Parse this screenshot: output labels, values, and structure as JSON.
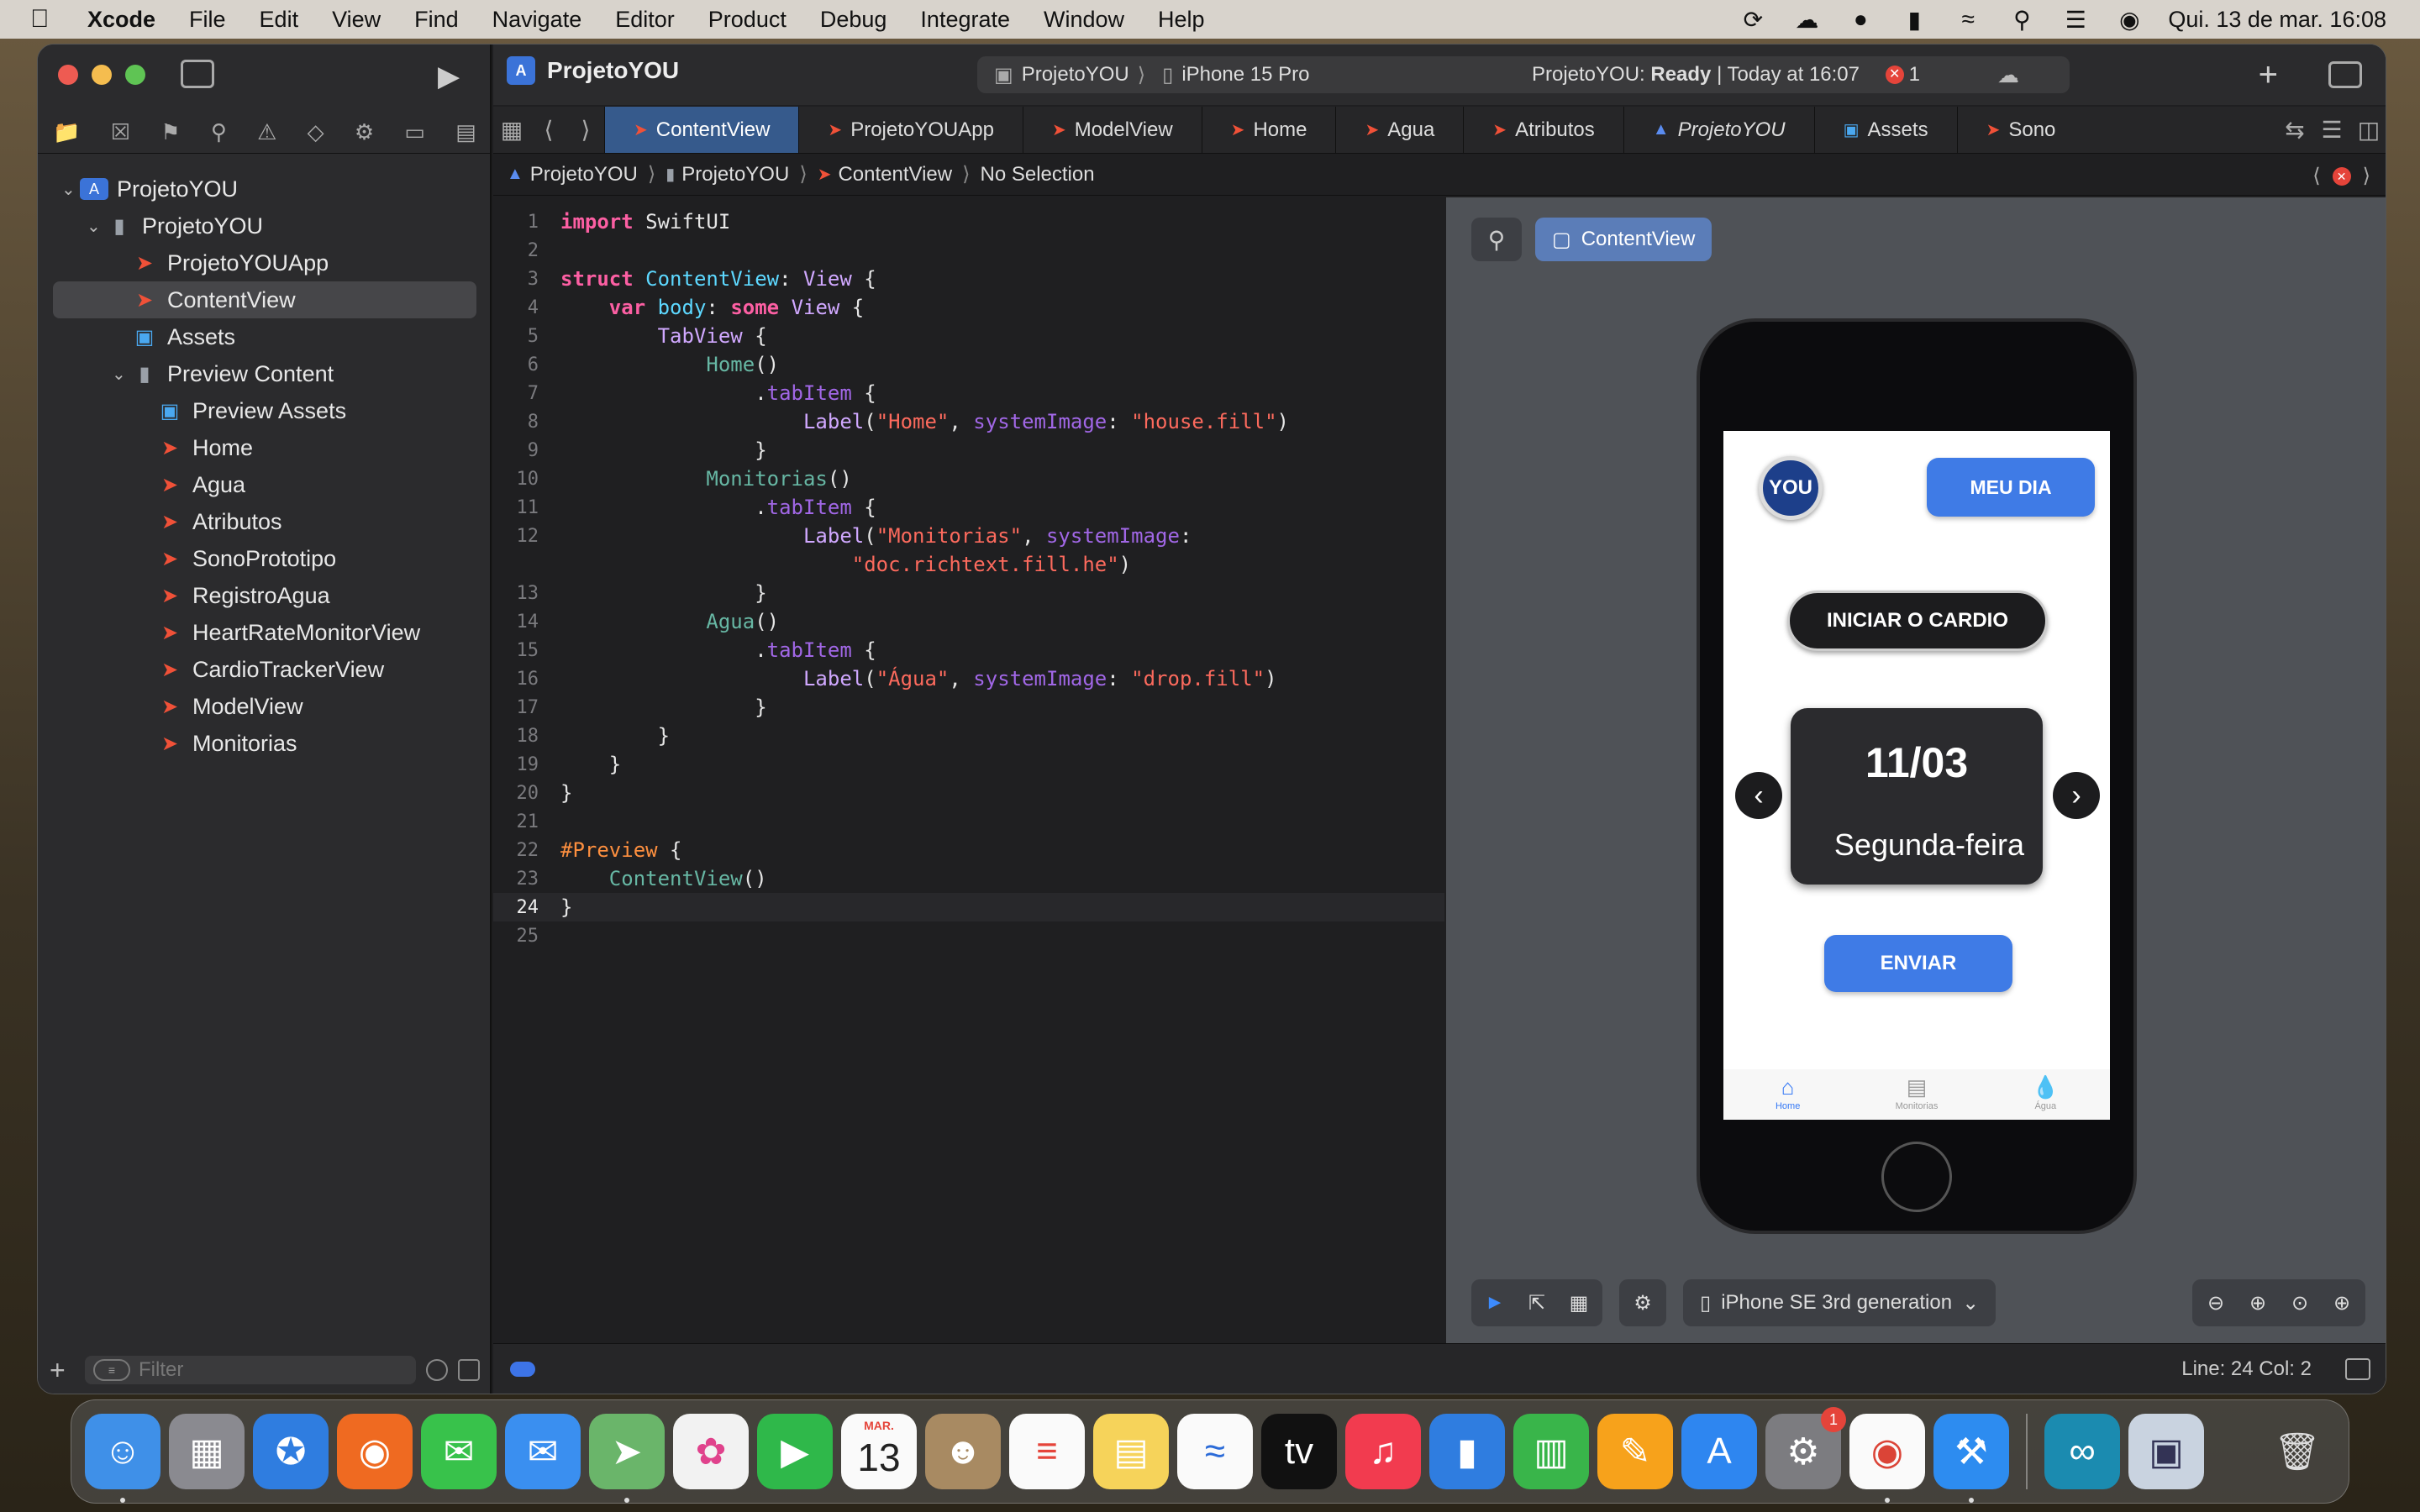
{
  "menubar": {
    "app_name": "Xcode",
    "items": [
      "File",
      "Edit",
      "View",
      "Find",
      "Navigate",
      "Editor",
      "Product",
      "Debug",
      "Integrate",
      "Window",
      "Help"
    ],
    "clock": "Qui. 13 de mar.  16:08"
  },
  "toolbar": {
    "project_name": "ProjetoYOU",
    "scheme": "ProjetoYOU",
    "device": "iPhone 15 Pro",
    "status_prefix": "ProjetoYOU: ",
    "status_state": "Ready",
    "status_time": " | Today at 16:07",
    "error_count": "1"
  },
  "tabs": [
    {
      "label": "ContentView",
      "active": true
    },
    {
      "label": "ProjetoYOUApp"
    },
    {
      "label": "ModelView"
    },
    {
      "label": "Home"
    },
    {
      "label": "Agua"
    },
    {
      "label": "Atributos"
    },
    {
      "label": "ProjetoYOU",
      "italic": true
    },
    {
      "label": "Assets"
    },
    {
      "label": "Sono"
    }
  ],
  "jumpbar": {
    "crumbs": [
      "ProjetoYOU",
      "ProjetoYOU",
      "ContentView",
      "No Selection"
    ]
  },
  "file_tree": [
    {
      "label": "ProjetoYOU",
      "type": "proj",
      "depth": 0,
      "chevron": true
    },
    {
      "label": "ProjetoYOU",
      "type": "folder",
      "depth": 1,
      "chevron": true
    },
    {
      "label": "ProjetoYOUApp",
      "type": "swift",
      "depth": 2
    },
    {
      "label": "ContentView",
      "type": "swift",
      "depth": 2,
      "selected": true
    },
    {
      "label": "Assets",
      "type": "assets",
      "depth": 2
    },
    {
      "label": "Preview Content",
      "type": "folder",
      "depth": 2,
      "chevron": true
    },
    {
      "label": "Preview Assets",
      "type": "assets",
      "depth": 3
    },
    {
      "label": "Home",
      "type": "swift",
      "depth": 3
    },
    {
      "label": "Agua",
      "type": "swift",
      "depth": 3
    },
    {
      "label": "Atributos",
      "type": "swift",
      "depth": 3
    },
    {
      "label": "SonoPrototipo",
      "type": "swift",
      "depth": 3
    },
    {
      "label": "RegistroAgua",
      "type": "swift",
      "depth": 3
    },
    {
      "label": "HeartRateMonitorView",
      "type": "swift",
      "depth": 3
    },
    {
      "label": "CardioTrackerView",
      "type": "swift",
      "depth": 3
    },
    {
      "label": "ModelView",
      "type": "swift",
      "depth": 3
    },
    {
      "label": "Monitorias",
      "type": "swift",
      "depth": 3
    }
  ],
  "filter": {
    "placeholder": "Filter"
  },
  "code_lines": [
    {
      "n": "1",
      "html": "<span class='kw'>import</span> SwiftUI"
    },
    {
      "n": "2",
      "html": ""
    },
    {
      "n": "3",
      "html": "<span class='kw'>struct</span> <span class='ty2'>ContentView</span>: <span class='ty'>View</span> {"
    },
    {
      "n": "4",
      "html": "    <span class='kw'>var</span> <span class='ty2'>body</span>: <span class='kw'>some</span> <span class='ty'>View</span> {"
    },
    {
      "n": "5",
      "html": "        <span class='ty'>TabView</span> {"
    },
    {
      "n": "6",
      "html": "            <span class='prp'>Home</span>()"
    },
    {
      "n": "7",
      "html": "                .<span class='fn'>tabItem</span> {"
    },
    {
      "n": "8",
      "html": "                    <span class='ty'>Label</span>(<span class='str'>\"Home\"</span>, <span class='fn'>systemImage</span>: <span class='str'>\"house.fill\"</span>)"
    },
    {
      "n": "9",
      "html": "                }"
    },
    {
      "n": "10",
      "html": "            <span class='prp'>Monitorias</span>()"
    },
    {
      "n": "11",
      "html": "                .<span class='fn'>tabItem</span> {"
    },
    {
      "n": "12",
      "html": "                    <span class='ty'>Label</span>(<span class='str'>\"Monitorias\"</span>, <span class='fn'>systemImage</span>:"
    },
    {
      "n": "",
      "html": "                        <span class='str'>\"doc.richtext.fill.he\"</span>)"
    },
    {
      "n": "13",
      "html": "                }"
    },
    {
      "n": "14",
      "html": "            <span class='prp'>Agua</span>()"
    },
    {
      "n": "15",
      "html": "                .<span class='fn'>tabItem</span> {"
    },
    {
      "n": "16",
      "html": "                    <span class='ty'>Label</span>(<span class='str'>\"Água\"</span>, <span class='fn'>systemImage</span>: <span class='str'>\"drop.fill\"</span>)"
    },
    {
      "n": "17",
      "html": "                }"
    },
    {
      "n": "18",
      "html": "        }"
    },
    {
      "n": "19",
      "html": "    }"
    },
    {
      "n": "20",
      "html": "}"
    },
    {
      "n": "21",
      "html": ""
    },
    {
      "n": "22",
      "html": "<span class='mac'>#Preview</span> {"
    },
    {
      "n": "23",
      "html": "    <span class='prp'>ContentView</span>()"
    },
    {
      "n": "24",
      "html": "}",
      "current": true
    },
    {
      "n": "25",
      "html": ""
    }
  ],
  "preview": {
    "tab_label": "ContentView",
    "device_label": "iPhone SE 3rd generation",
    "app": {
      "logo": "YOU",
      "meu_dia": "MEU DIA",
      "cardio": "INICIAR O CARDIO",
      "date": "11/03",
      "weekday": "Segunda-feira",
      "send": "ENVIAR",
      "tabs": [
        {
          "label": "Home",
          "icon": "house-icon"
        },
        {
          "label": "Monitorias",
          "icon": "doc-icon"
        },
        {
          "label": "Água",
          "icon": "drop-icon"
        }
      ]
    }
  },
  "statusbar": {
    "linecol": "Line: 24  Col: 2"
  },
  "dock": {
    "calendar_month": "MAR.",
    "calendar_day": "13",
    "settings_badge": "1"
  },
  "colors": {
    "accent": "#3d8bfd",
    "app_button_blue": "#3f7be6",
    "error_red": "#e5443a",
    "swift_orange": "#f05138"
  }
}
